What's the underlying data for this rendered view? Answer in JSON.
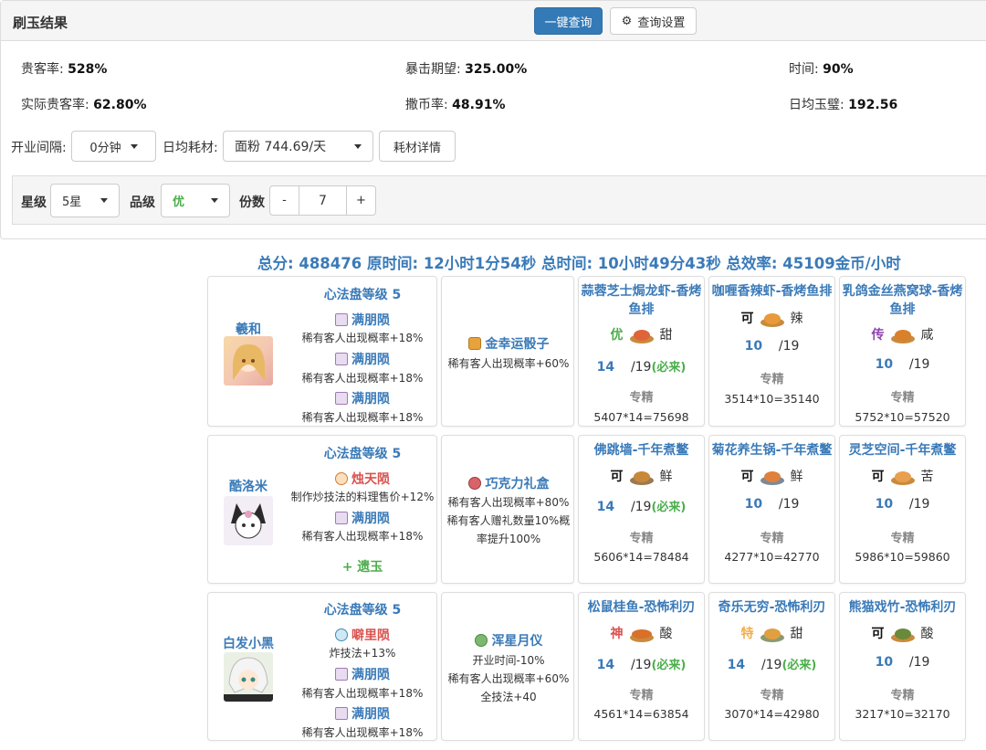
{
  "header": {
    "title": "刷玉结果",
    "query_btn": "一键查询",
    "settings_btn": "查询设置"
  },
  "stats": {
    "guest_rate_label": "贵客率:",
    "guest_rate": "528%",
    "crit_label": "暴击期望:",
    "crit": "325.00%",
    "time_label": "时间:",
    "time": "90%",
    "actual_label": "实际贵客率:",
    "actual": "62.80%",
    "coin_label": "撒币率:",
    "coin": "48.91%",
    "jade_label": "日均玉璧:",
    "jade": "192.56"
  },
  "controls": {
    "interval_label": "开业间隔:",
    "interval_value": "0分钟",
    "consume_label": "日均耗材:",
    "consume_value": "面粉 744.69/天",
    "consume_detail_btn": "耗材详情"
  },
  "filter": {
    "star_label": "星级",
    "star_value": "5星",
    "grade_label": "品级",
    "grade_value": "优",
    "portion_label": "份数",
    "minus": "-",
    "portion_value": "7",
    "plus": "+"
  },
  "summary": "总分: 488476 原时间: 12小时1分54秒 总时间: 10小时49分43秒 总效率: 45109金币/小时",
  "rows": [
    {
      "chef": {
        "name": "羲和",
        "level": "心法盘等级 5",
        "slots": [
          {
            "name": "满朋陨",
            "desc": "稀有客人出现概率+18%"
          },
          {
            "name": "满朋陨",
            "desc": "稀有客人出现概率+18%"
          },
          {
            "name": "满朋陨",
            "desc": "稀有客人出现概率+18%"
          }
        ]
      },
      "gear": {
        "name": "金幸运骰子",
        "desc": [
          "稀有客人出现概率+60%"
        ]
      },
      "dishes": [
        {
          "name": "蒜蓉芝士焗龙虾-香烤鱼排",
          "grade": "优",
          "taste": "甜",
          "count": "14",
          "total": "/19",
          "must": "(必来)",
          "zj": "专精",
          "formula": "5407*14=75698"
        },
        {
          "name": "咖喱香辣虾-香烤鱼排",
          "grade": "可",
          "taste": "辣",
          "count": "10",
          "total": "/19",
          "must": "",
          "zj": "专精",
          "formula": "3514*10=35140"
        },
        {
          "name": "乳鸽金丝燕窝球-香烤鱼排",
          "grade": "传",
          "taste": "咸",
          "count": "10",
          "total": "/19",
          "must": "",
          "zj": "专精",
          "formula": "5752*10=57520"
        }
      ]
    },
    {
      "chef": {
        "name": "酷洛米",
        "level": "心法盘等级 5",
        "slots": [
          {
            "name": "烛天陨",
            "desc": "制作炒技法的料理售价+12%"
          },
          {
            "name": "满朋陨",
            "desc": "稀有客人出现概率+18%"
          }
        ],
        "extra": "+ 遗玉"
      },
      "gear": {
        "name": "巧克力礼盒",
        "desc": [
          "稀有客人出现概率+80%",
          "稀有客人赠礼数量10%概",
          "率提升100%"
        ]
      },
      "dishes": [
        {
          "name": "佛跳墙-千年煮鳖",
          "grade": "可",
          "taste": "鲜",
          "count": "14",
          "total": "/19",
          "must": "(必来)",
          "zj": "专精",
          "formula": "5606*14=78484"
        },
        {
          "name": "菊花养生锅-千年煮鳖",
          "grade": "可",
          "taste": "鲜",
          "count": "10",
          "total": "/19",
          "must": "",
          "zj": "专精",
          "formula": "4277*10=42770"
        },
        {
          "name": "灵芝空间-千年煮鳖",
          "grade": "可",
          "taste": "苦",
          "count": "10",
          "total": "/19",
          "must": "",
          "zj": "专精",
          "formula": "5986*10=59860"
        }
      ]
    },
    {
      "chef": {
        "name": "白发小黑",
        "level": "心法盘等级 5",
        "slots": [
          {
            "name": "噼里陨",
            "desc": "炸技法+13%"
          },
          {
            "name": "满朋陨",
            "desc": "稀有客人出现概率+18%"
          },
          {
            "name": "满朋陨",
            "desc": "稀有客人出现概率+18%"
          }
        ]
      },
      "gear": {
        "name": "浑星月仪",
        "desc": [
          "开业时间-10%",
          "稀有客人出现概率+60%",
          "全技法+40"
        ]
      },
      "dishes": [
        {
          "name": "松鼠桂鱼-恐怖利刃",
          "grade": "神",
          "taste": "酸",
          "count": "14",
          "total": "/19",
          "must": "(必来)",
          "zj": "专精",
          "formula": "4561*14=63854"
        },
        {
          "name": "奇乐无穷-恐怖利刃",
          "grade": "特",
          "taste": "甜",
          "count": "14",
          "total": "/19",
          "must": "(必来)",
          "zj": "专精",
          "formula": "3070*14=42980"
        },
        {
          "name": "熊猫戏竹-恐怖利刃",
          "grade": "可",
          "taste": "酸",
          "count": "10",
          "total": "/19",
          "must": "",
          "zj": "专精",
          "formula": "3217*10=32170"
        }
      ]
    }
  ]
}
